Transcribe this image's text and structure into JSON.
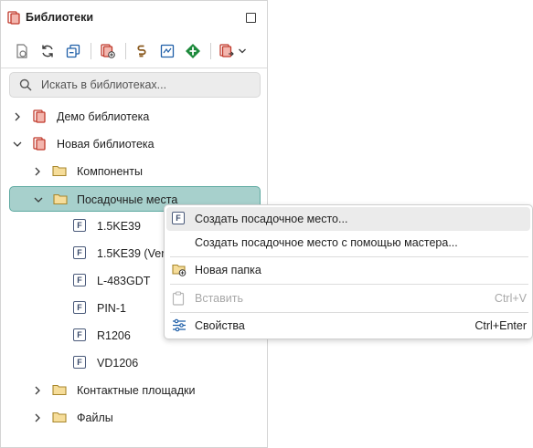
{
  "panel": {
    "title": "Библиотеки",
    "search_placeholder": "Искать в библиотеках..."
  },
  "toolbar": {
    "items": [
      "new-library-icon",
      "refresh-icon",
      "collapse-all-icon",
      "add-library-icon",
      "link-icon",
      "schematic-icon",
      "pin-icon",
      "export-icon",
      "chevron-down-icon"
    ]
  },
  "tree": {
    "demo": "Демо библиотека",
    "new_lib": "Новая библиотека",
    "components": "Компоненты",
    "footprints": "Посадочные места",
    "items": [
      "1.5KE39",
      "1.5KE39  (Ver",
      "L-483GDT",
      "PIN-1",
      "R1206",
      "VD1206"
    ],
    "pads": "Контактные площадки",
    "files": "Файлы"
  },
  "menu": {
    "create": "Создать посадочное место...",
    "create_wizard": "Создать посадочное место с помощью мастера...",
    "new_folder": "Новая папка",
    "paste": "Вставить",
    "paste_shortcut": "Ctrl+V",
    "properties": "Свойства",
    "properties_shortcut": "Ctrl+Enter"
  },
  "colors": {
    "selection": "#a7d0cc",
    "selection_border": "#5ea9a1",
    "library_red": "#c0392b",
    "folder": "#e9c46a"
  }
}
